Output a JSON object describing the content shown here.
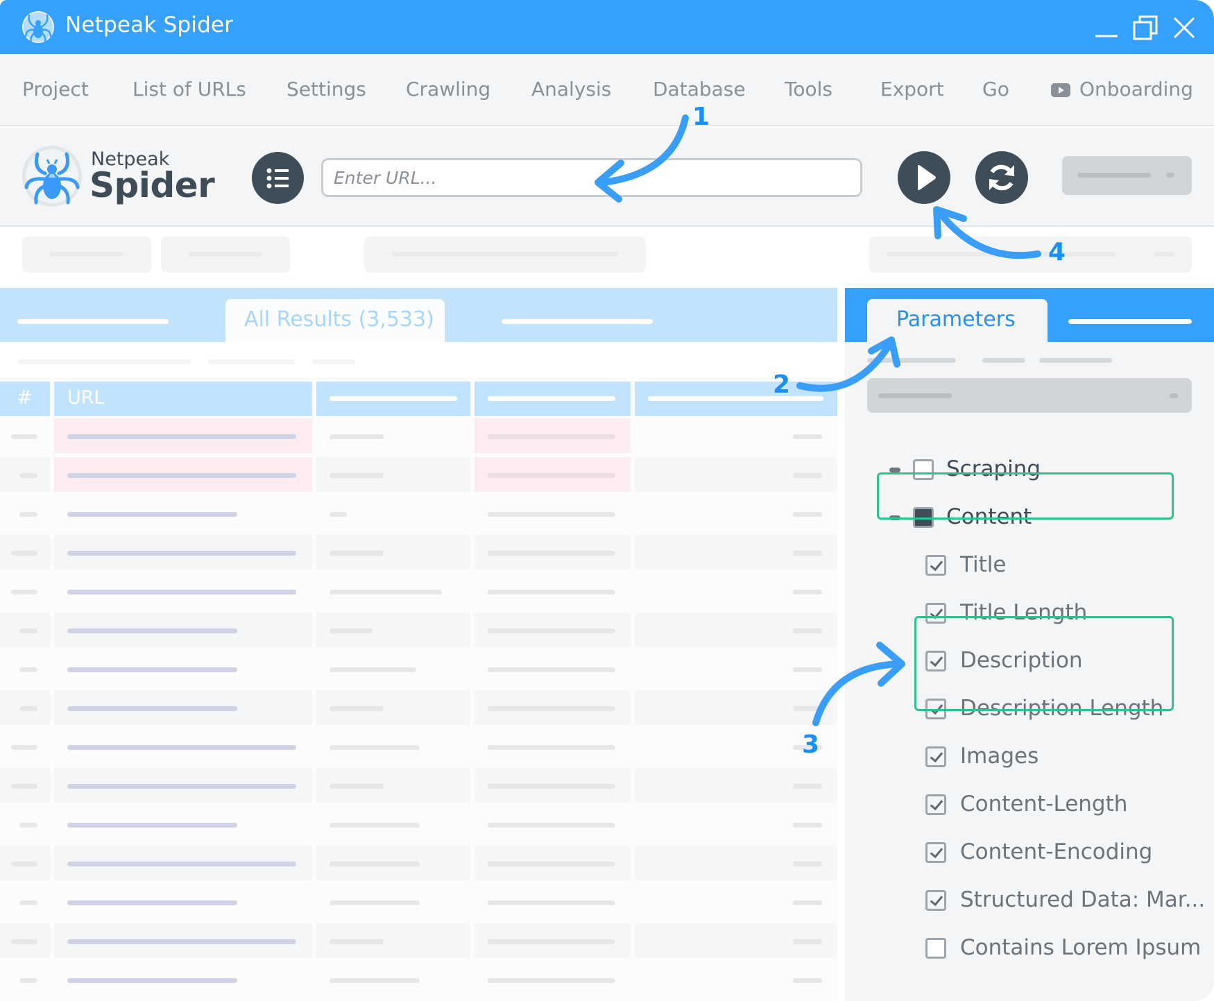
{
  "window": {
    "title": "Netpeak Spider",
    "controls": [
      "minimize",
      "restore",
      "close"
    ]
  },
  "menu": {
    "items": [
      "Project",
      "List of URLs",
      "Settings",
      "Crawling",
      "Analysis",
      "Database",
      "Tools",
      "Export",
      "Go",
      "Onboarding"
    ]
  },
  "toolbar": {
    "brand_line1": "Netpeak",
    "brand_line2": "Spider",
    "url_placeholder": "Enter URL...",
    "url_value": "",
    "start_button": "play-icon",
    "restart_button": "refresh-icon"
  },
  "results": {
    "active_tab": "All Results (3,533)",
    "columns": [
      "#",
      "URL"
    ],
    "row_count_visible": 15,
    "error_rows": [
      0,
      1
    ]
  },
  "parameters_panel": {
    "tab_label": "Parameters",
    "tree": [
      {
        "label": "Scraping",
        "level": 0,
        "state": "unchecked",
        "collapsible": true
      },
      {
        "label": "Content",
        "level": 0,
        "state": "partial",
        "collapsible": true,
        "highlighted": true
      },
      {
        "label": "Title",
        "level": 1,
        "state": "checked"
      },
      {
        "label": "Title Length",
        "level": 1,
        "state": "checked"
      },
      {
        "label": "Description",
        "level": 1,
        "state": "checked",
        "highlighted": true
      },
      {
        "label": "Description Length",
        "level": 1,
        "state": "checked",
        "highlighted": true
      },
      {
        "label": "Images",
        "level": 1,
        "state": "checked"
      },
      {
        "label": "Content-Length",
        "level": 1,
        "state": "checked"
      },
      {
        "label": "Content-Encoding",
        "level": 1,
        "state": "checked"
      },
      {
        "label": "Structured Data: Mar...",
        "level": 1,
        "state": "checked"
      },
      {
        "label": "Contains Lorem Ipsum",
        "level": 1,
        "state": "unchecked"
      }
    ]
  },
  "annotations": {
    "steps": [
      "1",
      "2",
      "3",
      "4"
    ],
    "color": "#1890f5",
    "highlight_color": "#2fc28e"
  },
  "colors": {
    "titlebar": "#36a1fd",
    "tab_light": "#c2e3fd",
    "dark_button": "#3f4d59",
    "error_cell": "#fdecef"
  }
}
